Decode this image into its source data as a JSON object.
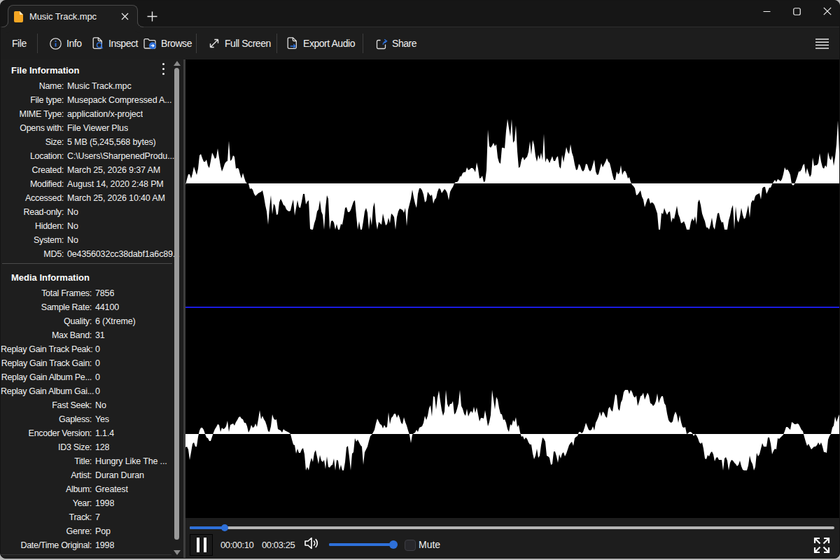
{
  "tab_bar": {
    "tab_title": "Music Track.mpc"
  },
  "toolbar": {
    "file_label": "File",
    "info_label": "Info",
    "inspect_label": "Inspect",
    "browse_label": "Browse",
    "fullscreen_label": "Full Screen",
    "export_audio_label": "Export Audio",
    "share_label": "Share"
  },
  "sidebar": {
    "sections": [
      {
        "title": "File Information",
        "label_col_width": 90,
        "rows": [
          {
            "label": "Name:",
            "value": "Music Track.mpc"
          },
          {
            "label": "File type:",
            "value": "Musepack Compressed A..."
          },
          {
            "label": "MIME Type:",
            "value": "application/x-project"
          },
          {
            "label": "Opens with:",
            "value": "File Viewer Plus"
          },
          {
            "label": "Size:",
            "value": "5 MB (5,245,568 bytes)"
          },
          {
            "label": "Location:",
            "value": "C:\\Users\\SharpenedProdu..."
          },
          {
            "label": "Created:",
            "value": "March 25, 2026 9:37 AM"
          },
          {
            "label": "Modified:",
            "value": "August 14, 2020 2:48 PM"
          },
          {
            "label": "Accessed:",
            "value": "March 25, 2026 10:40 AM"
          },
          {
            "label": "Read-only:",
            "value": "No"
          },
          {
            "label": "Hidden:",
            "value": "No"
          },
          {
            "label": "System:",
            "value": "No"
          },
          {
            "label": "MD5:",
            "value": "0e4356032cc38dabf1a6c89..."
          }
        ]
      },
      {
        "title": "Media Information",
        "label_col_width": 130,
        "rows": [
          {
            "label": "Total Frames:",
            "value": "7856"
          },
          {
            "label": "Sample Rate:",
            "value": "44100"
          },
          {
            "label": "Quality:",
            "value": "6 (Xtreme)"
          },
          {
            "label": "Max Band:",
            "value": "31"
          },
          {
            "label": "Replay Gain Track Peak:",
            "value": "0"
          },
          {
            "label": "Replay Gain Track Gain:",
            "value": "0"
          },
          {
            "label": "Replay Gain Album Pe...",
            "value": "0"
          },
          {
            "label": "Replay Gain Album Gai...",
            "value": "0"
          },
          {
            "label": "Fast Seek:",
            "value": "No"
          },
          {
            "label": "Gapless:",
            "value": "Yes"
          },
          {
            "label": "Encoder Version:",
            "value": "1.1.4"
          },
          {
            "label": "ID3 Size:",
            "value": "128"
          },
          {
            "label": "Title:",
            "value": "Hungry Like The ..."
          },
          {
            "label": "Artist:",
            "value": "Duran Duran"
          },
          {
            "label": "Album:",
            "value": "Greatest"
          },
          {
            "label": "Year:",
            "value": "1998"
          },
          {
            "label": "Track:",
            "value": "7"
          },
          {
            "label": "Genre:",
            "value": "Pop"
          },
          {
            "label": "Date/Time Original:",
            "value": "1998"
          }
        ]
      }
    ]
  },
  "player": {
    "elapsed": "00:00:10",
    "duration": "00:03:25",
    "mute_label": "Mute",
    "seek_progress": 0.0543,
    "volume_level": 0.99
  },
  "waveform": {
    "step": 2,
    "top": [
      -2,
      6,
      13,
      13,
      7,
      14,
      24,
      18,
      12,
      21,
      40,
      42,
      36,
      31,
      31,
      34,
      25,
      22,
      32,
      44,
      40,
      35,
      37,
      50,
      37,
      25,
      17,
      22,
      28,
      31,
      32,
      61,
      32,
      34,
      40,
      38,
      21,
      22,
      21,
      13,
      7,
      15,
      8,
      2,
      0,
      0,
      -8,
      -7,
      -9,
      -15,
      -18,
      -16,
      -14,
      -13,
      -12,
      -10,
      -19,
      -31,
      -40,
      -59,
      -35,
      -17,
      -44,
      -29,
      -32,
      -45,
      -44,
      -27,
      -22,
      -26,
      -31,
      -32,
      -37,
      -39,
      -40,
      -39,
      -30,
      -23,
      -46,
      -35,
      -24,
      -34,
      -35,
      -26,
      -15,
      -15,
      -30,
      -26,
      -24,
      -65,
      -66,
      -66,
      -57,
      -51,
      -40,
      -37,
      -24,
      -40,
      -45,
      -66,
      -35,
      -17,
      -22,
      -66,
      -54,
      -53,
      -56,
      -66,
      -58,
      -66,
      -66,
      -58,
      -59,
      -48,
      -35,
      -34,
      -41,
      -41,
      -38,
      -32,
      -26,
      -24,
      -46,
      -66,
      -54,
      -66,
      -66,
      -54,
      -40,
      -35,
      -42,
      -66,
      -47,
      -60,
      -34,
      -27,
      -54,
      -66,
      -55,
      -57,
      -59,
      -43,
      -52,
      -60,
      -58,
      -49,
      -57,
      -43,
      -45,
      -48,
      -66,
      -48,
      -40,
      -36,
      -37,
      -38,
      -42,
      -35,
      -61,
      -38,
      -30,
      -22,
      -9,
      -20,
      -29,
      -35,
      -15,
      -7,
      -7,
      -10,
      -16,
      -27,
      -25,
      -12,
      -15,
      -18,
      -16,
      -29,
      -23,
      -21,
      -12,
      -7,
      -8,
      -14,
      -11,
      -8,
      -10,
      -14,
      -24,
      -12,
      -8,
      -5,
      0,
      2,
      2,
      4,
      10,
      10,
      15,
      16,
      16,
      23,
      19,
      20,
      22,
      22,
      20,
      16,
      30,
      21,
      7,
      8,
      11,
      2,
      3,
      19,
      77,
      53,
      51,
      54,
      58,
      53,
      56,
      37,
      30,
      28,
      51,
      51,
      50,
      75,
      92,
      79,
      67,
      92,
      58,
      61,
      83,
      46,
      22,
      24,
      34,
      38,
      33,
      36,
      38,
      45,
      60,
      41,
      62,
      55,
      39,
      31,
      41,
      34,
      44,
      33,
      71,
      30,
      36,
      34,
      29,
      34,
      39,
      32,
      32,
      37,
      39,
      24,
      21,
      41,
      30,
      41,
      52,
      45,
      42,
      56,
      44,
      38,
      27,
      19,
      20,
      28,
      25,
      19,
      17,
      20,
      28,
      27,
      20,
      17,
      20,
      27,
      34,
      17,
      12,
      13,
      21,
      29,
      23,
      27,
      31,
      36,
      31,
      29,
      21,
      12,
      5,
      5,
      17,
      13,
      15,
      26,
      12,
      17,
      18,
      14,
      7,
      9,
      2,
      -2,
      -4,
      -7,
      -17,
      -16,
      -13,
      -10,
      -19,
      -23,
      -34,
      -28,
      -22,
      -21,
      -29,
      -27,
      -28,
      -31,
      -37,
      -43,
      -66,
      -66,
      -42,
      -44,
      -35,
      -41,
      -45,
      -41,
      -40,
      -56,
      -49,
      -51,
      -42,
      -32,
      -44,
      -49,
      -57,
      -56,
      -54,
      -59,
      -66,
      -66,
      -66,
      -55,
      -50,
      -54,
      -47,
      -59,
      -27,
      -23,
      -31,
      -43,
      -49,
      -54,
      -63,
      -63,
      -66,
      -59,
      -49,
      -62,
      -66,
      -54,
      -43,
      -42,
      -51,
      -56,
      -55,
      -66,
      -66,
      -66,
      -53,
      -46,
      -36,
      -31,
      -66,
      -33,
      -52,
      -56,
      -48,
      -35,
      -45,
      -51,
      -49,
      -40,
      -31,
      -49,
      -28,
      -24,
      -25,
      -18,
      -16,
      -15,
      -14,
      -23,
      -7,
      -5,
      -5,
      -15,
      -11,
      -6,
      -6,
      -1,
      2,
      5,
      2,
      6,
      5,
      3,
      6,
      13,
      23,
      19,
      20,
      17,
      12,
      -1,
      -3,
      -1,
      4,
      10,
      17,
      17,
      20,
      26,
      28,
      13,
      22,
      15,
      9,
      13,
      37,
      25,
      26,
      26,
      29,
      43,
      31,
      23,
      21,
      26,
      23,
      45,
      36,
      33,
      40,
      25,
      37,
      56,
      90,
      43,
      38
    ],
    "bottom": [
      -19,
      -18,
      -22,
      -37,
      -26,
      -14,
      -12,
      -18,
      -18,
      -4,
      5,
      9,
      9,
      6,
      0,
      -5,
      -6,
      -10,
      -10,
      -4,
      2,
      7,
      10,
      14,
      13,
      3,
      9,
      7,
      8,
      11,
      19,
      3,
      13,
      14,
      15,
      12,
      17,
      20,
      24,
      25,
      22,
      21,
      16,
      16,
      11,
      2,
      6,
      13,
      9,
      10,
      15,
      10,
      21,
      34,
      21,
      26,
      21,
      18,
      12,
      4,
      3,
      11,
      28,
      22,
      20,
      21,
      7,
      6,
      5,
      2,
      7,
      5,
      4,
      3,
      2,
      0,
      -8,
      -15,
      -16,
      -28,
      -21,
      -27,
      -27,
      -22,
      -20,
      -29,
      -52,
      -47,
      -52,
      -41,
      -34,
      -40,
      -27,
      -23,
      -33,
      -43,
      -30,
      -38,
      -40,
      -37,
      -50,
      -32,
      -47,
      -48,
      -45,
      -44,
      -35,
      -52,
      -37,
      -38,
      -52,
      -44,
      -52,
      -52,
      -40,
      -19,
      -17,
      -33,
      -52,
      -28,
      -26,
      -6,
      -11,
      -8,
      -12,
      -16,
      -18,
      -44,
      -26,
      -22,
      -18,
      -10,
      -3,
      -1,
      2,
      6,
      15,
      22,
      18,
      14,
      13,
      8,
      13,
      9,
      10,
      31,
      14,
      23,
      25,
      29,
      29,
      23,
      28,
      23,
      16,
      14,
      24,
      17,
      12,
      5,
      -1,
      -13,
      -1,
      1,
      2,
      6,
      3,
      9,
      10,
      11,
      16,
      26,
      20,
      26,
      37,
      41,
      25,
      54,
      53,
      35,
      52,
      62,
      47,
      34,
      26,
      32,
      63,
      43,
      38,
      43,
      43,
      47,
      28,
      30,
      36,
      44,
      63,
      40,
      36,
      29,
      26,
      36,
      25,
      30,
      33,
      30,
      39,
      30,
      38,
      28,
      18,
      23,
      23,
      22,
      34,
      23,
      11,
      17,
      27,
      63,
      49,
      35,
      53,
      49,
      37,
      29,
      28,
      20,
      21,
      16,
      7,
      3,
      14,
      12,
      20,
      17,
      24,
      10,
      13,
      2,
      -4,
      -3,
      -8,
      -5,
      -7,
      -12,
      -15,
      -15,
      -28,
      -36,
      -31,
      -21,
      -34,
      -31,
      -16,
      -5,
      -7,
      -11,
      -31,
      -32,
      -34,
      -44,
      -43,
      -25,
      -25,
      -32,
      -41,
      -29,
      -35,
      -28,
      -26,
      -32,
      -28,
      -22,
      -16,
      -13,
      -11,
      -17,
      -6,
      -4,
      -3,
      3,
      3,
      1,
      3,
      9,
      16,
      11,
      6,
      5,
      6,
      11,
      5,
      16,
      20,
      25,
      32,
      25,
      32,
      30,
      25,
      23,
      36,
      39,
      34,
      32,
      44,
      57,
      55,
      36,
      33,
      45,
      49,
      60,
      63,
      63,
      63,
      57,
      63,
      60,
      54,
      52,
      55,
      40,
      46,
      54,
      55,
      59,
      49,
      54,
      59,
      55,
      44,
      43,
      40,
      42,
      47,
      58,
      44,
      50,
      54,
      54,
      44,
      41,
      29,
      20,
      17,
      16,
      18,
      27,
      32,
      27,
      16,
      27,
      17,
      10,
      9,
      10,
      0,
      1,
      3,
      3,
      1,
      -3,
      0,
      -2,
      -6,
      -12,
      -14,
      -12,
      -21,
      -35,
      -36,
      -30,
      -32,
      -27,
      -25,
      -29,
      -39,
      -34,
      -33,
      -37,
      -37,
      -37,
      -52,
      -35,
      -33,
      -38,
      -52,
      -41,
      -37,
      -38,
      -41,
      -43,
      -46,
      -44,
      -38,
      -46,
      -51,
      -52,
      -52,
      -52,
      -45,
      -31,
      -39,
      -43,
      -52,
      -47,
      -27,
      -32,
      -29,
      -21,
      -13,
      -18,
      -18,
      -18,
      -5,
      -5,
      -14,
      -29,
      -24,
      -21,
      -22,
      -6,
      -7,
      -5,
      -3,
      -1,
      4,
      10,
      10,
      8,
      6,
      17,
      16,
      14,
      14,
      15,
      14,
      10,
      6,
      4,
      -4,
      -11,
      -17,
      -14,
      -18,
      -22,
      -20,
      -18,
      -18,
      -16,
      -12,
      -16,
      -12,
      -18,
      -26,
      -26,
      -27,
      -8,
      -3,
      0,
      9,
      12,
      25,
      17,
      23,
      28,
      18
    ]
  },
  "colors": {
    "accent_blue": "#2e70d9",
    "center_line_blue": "#1b1be0",
    "tab_icon_orange": "#f5a623",
    "waveform_white": "#ffffff"
  }
}
